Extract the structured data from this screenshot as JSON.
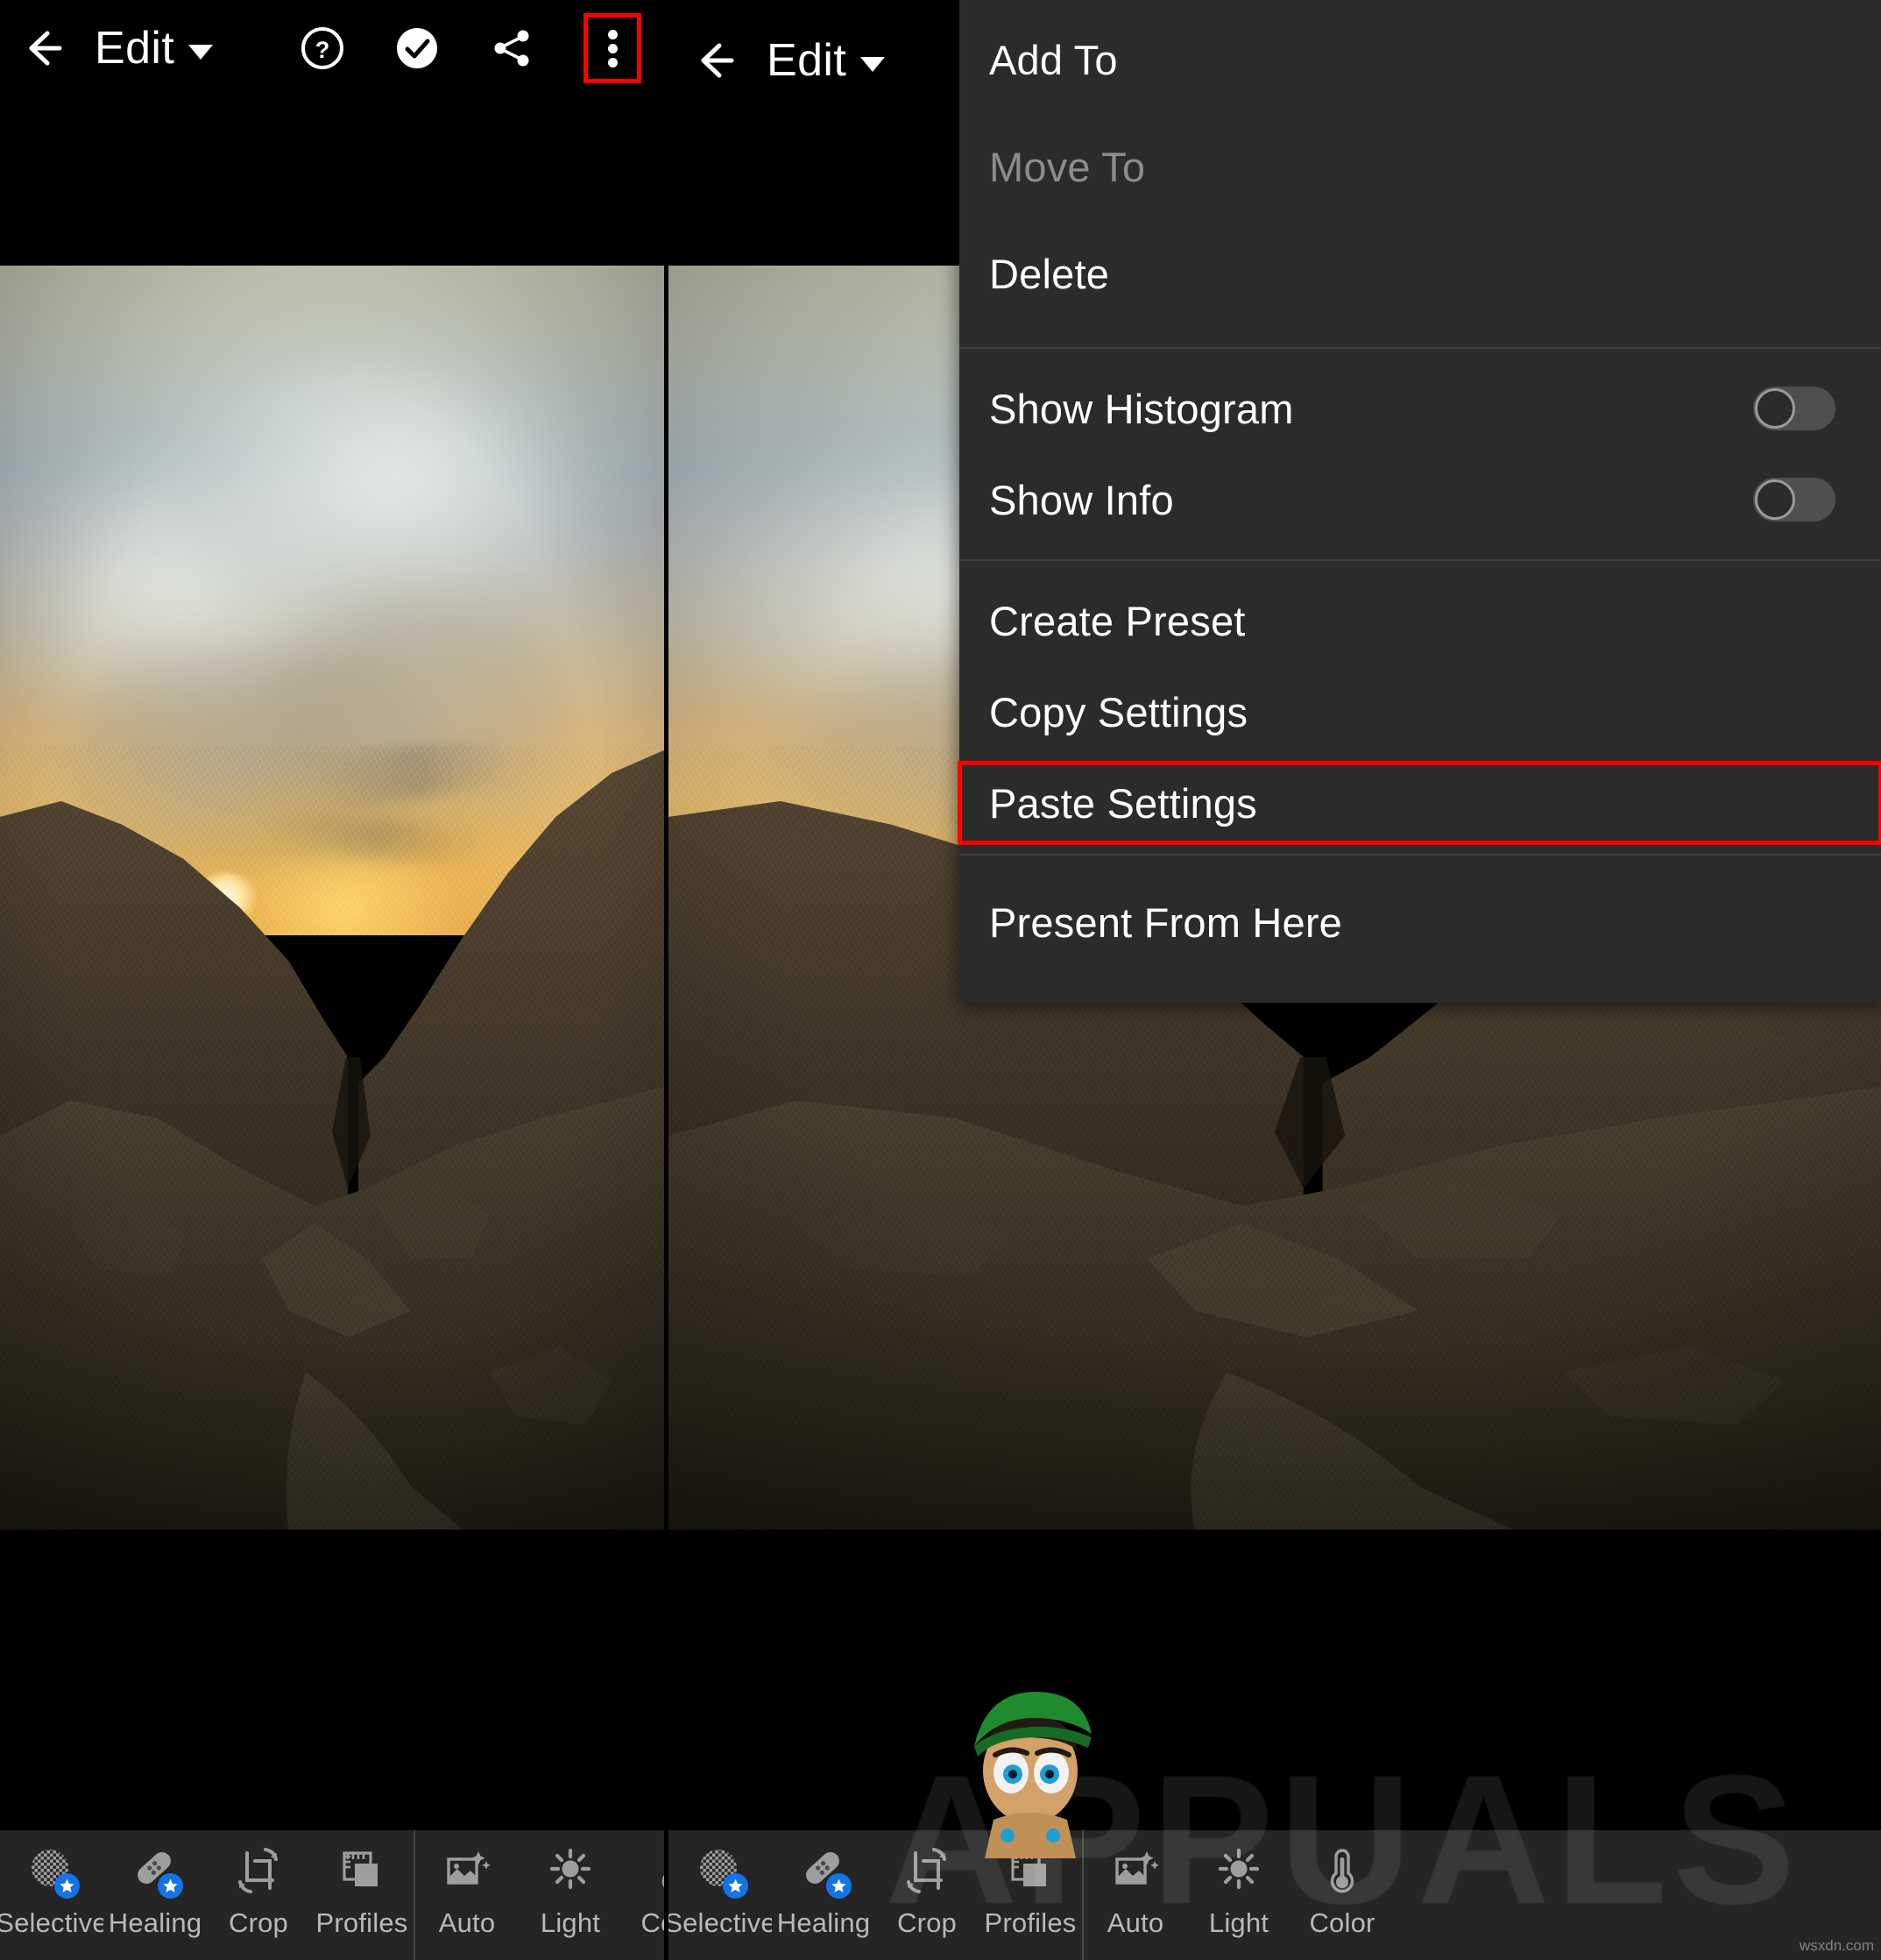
{
  "app": {
    "name": "Adobe Lightroom Mobile",
    "accent_blue": "#1473e6",
    "annotation_red": "#ff0000",
    "menu_bg": "#2b2b2b",
    "toolbar_bg": "#252525"
  },
  "appbar": {
    "back_icon": "back-arrow-icon",
    "title": "Edit",
    "dropdown_icon": "chevron-down-icon",
    "actions": [
      {
        "name": "help-icon",
        "glyph": "?"
      },
      {
        "name": "check-circle-icon",
        "glyph": "✓"
      },
      {
        "name": "share-icon",
        "glyph": "share"
      },
      {
        "name": "overflow-menu-icon",
        "glyph": "⋮"
      }
    ]
  },
  "overflow_menu": {
    "groups": [
      {
        "items": [
          {
            "label": "Add To",
            "type": "action",
            "disabled": false,
            "highlighted": false
          },
          {
            "label": "Move To",
            "type": "action",
            "disabled": true,
            "highlighted": false
          },
          {
            "label": "Delete",
            "type": "action",
            "disabled": false,
            "highlighted": false
          }
        ]
      },
      {
        "items": [
          {
            "label": "Show Histogram",
            "type": "toggle",
            "value": "off",
            "disabled": false,
            "highlighted": false
          },
          {
            "label": "Show Info",
            "type": "toggle",
            "value": "off",
            "disabled": false,
            "highlighted": false
          }
        ]
      },
      {
        "items": [
          {
            "label": "Create Preset",
            "type": "action",
            "disabled": false,
            "highlighted": false
          },
          {
            "label": "Copy Settings",
            "type": "action",
            "disabled": false,
            "highlighted": false
          },
          {
            "label": "Paste Settings",
            "type": "action",
            "disabled": false,
            "highlighted": true
          }
        ]
      },
      {
        "items": [
          {
            "label": "Present From Here",
            "type": "action",
            "disabled": false,
            "highlighted": false
          }
        ]
      }
    ]
  },
  "toolbar": {
    "left_group": [
      {
        "label": "Selective",
        "icon": "selective-icon",
        "premium": true
      },
      {
        "label": "Healing",
        "icon": "healing-icon",
        "premium": true
      },
      {
        "label": "Crop",
        "icon": "crop-icon",
        "premium": false
      },
      {
        "label": "Profiles",
        "icon": "profiles-icon",
        "premium": false
      }
    ],
    "right_group": [
      {
        "label": "Auto",
        "icon": "auto-icon",
        "premium": false
      },
      {
        "label": "Light",
        "icon": "light-icon",
        "premium": false
      },
      {
        "label": "Color",
        "icon": "color-icon",
        "premium": false
      }
    ]
  },
  "photo": {
    "alt": "Desert mountain valley at sunset with golden sky",
    "sky_top": "#cdcfb8",
    "sky_horizon": "#e8b862",
    "ridge_color": "#3e3224",
    "foreground_color": "#2a2418"
  },
  "watermark": {
    "brand": "APPUALS",
    "mascot": "appuals-mascot-icon",
    "credit": "wsxdn.com"
  }
}
